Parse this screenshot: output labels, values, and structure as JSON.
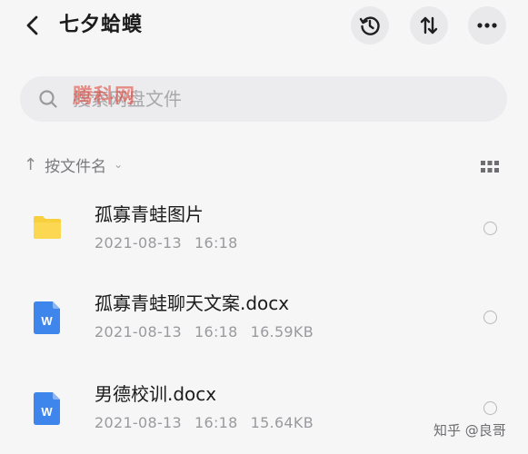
{
  "header": {
    "title": "七夕蛤蟆",
    "back_icon": "chevron-left-icon",
    "actions": [
      {
        "name": "history-icon"
      },
      {
        "name": "sort-icon"
      },
      {
        "name": "more-icon"
      }
    ]
  },
  "search": {
    "placeholder": "搜索网盘文件",
    "icon": "search-icon",
    "watermark": "腾科网"
  },
  "sort": {
    "label": "按文件名",
    "grid_icon": "grid-view-icon"
  },
  "files": [
    {
      "name": "孤寡青蛙图片",
      "date": "2021-08-13",
      "time": "16:18",
      "size": "",
      "type": "folder",
      "color": "#f8cf3d"
    },
    {
      "name": "孤寡青蛙聊天文案.docx",
      "date": "2021-08-13",
      "time": "16:18",
      "size": "16.59KB",
      "type": "word",
      "color": "#3f86ec"
    },
    {
      "name": "男德校训.docx",
      "date": "2021-08-13",
      "time": "16:18",
      "size": "15.64KB",
      "type": "word",
      "color": "#3f86ec"
    }
  ],
  "credit": "知乎 @良哥"
}
